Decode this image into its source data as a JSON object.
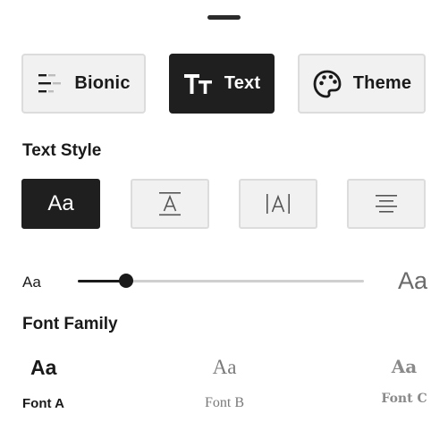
{
  "modes": {
    "bionic_label": "Bionic",
    "text_label": "Text",
    "theme_label": "Theme",
    "active": "text"
  },
  "text_style": {
    "title": "Text Style",
    "options": [
      "Aa"
    ],
    "active_index": 0,
    "icons": [
      "aa-icon",
      "overline-a-icon",
      "bar-a-icon",
      "align-justify-icon"
    ]
  },
  "font_size": {
    "small_label": "Aa",
    "large_label": "Aa",
    "level_fraction": 0.17
  },
  "font_family": {
    "title": "Font Family",
    "fonts": [
      {
        "sample": "Aa",
        "name": "Font A"
      },
      {
        "sample": "Aa",
        "name": "Font B"
      },
      {
        "sample": "Aa",
        "name": "Font C"
      }
    ],
    "selected_index": 0
  },
  "colors": {
    "active_bg": "#1f1f1f",
    "inactive_bg": "#f1f1f1",
    "border": "#dcdcdc",
    "muted_text": "#7a7a7a"
  }
}
